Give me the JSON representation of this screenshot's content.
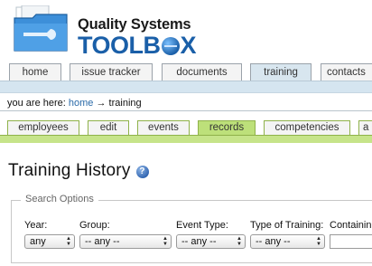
{
  "logo": {
    "line1": "Quality Systems",
    "line2_before": "TOOLB",
    "line2_after": "X"
  },
  "main_tabs": [
    {
      "label": "home",
      "active": false
    },
    {
      "label": "issue tracker",
      "active": false
    },
    {
      "label": "documents",
      "active": false
    },
    {
      "label": "training",
      "active": true
    },
    {
      "label": "contacts",
      "active": false
    }
  ],
  "breadcrumb": {
    "prefix": "you are here:",
    "home": "home",
    "separator": "→",
    "current": "training"
  },
  "sub_tabs": [
    {
      "label": "employees",
      "active": false
    },
    {
      "label": "edit",
      "active": false
    },
    {
      "label": "events",
      "active": false
    },
    {
      "label": "records",
      "active": true
    },
    {
      "label": "competencies",
      "active": false
    },
    {
      "label": "a",
      "active": false
    }
  ],
  "page": {
    "title": "Training History",
    "help_glyph": "?"
  },
  "search": {
    "legend": "Search Options",
    "year_label": "Year:",
    "year_value": "any",
    "group_label": "Group:",
    "group_value": "-- any --",
    "event_type_label": "Event Type:",
    "event_type_value": "-- any --",
    "training_type_label": "Type of Training:",
    "training_type_value": "-- any --",
    "containing_label": "Containin",
    "containing_value": ""
  },
  "colors": {
    "brand_blue": "#1a5fa8",
    "main_nav_bar": "#d5e5f0",
    "sub_nav_bar": "#c6e48a",
    "link": "#2a6aa8"
  }
}
